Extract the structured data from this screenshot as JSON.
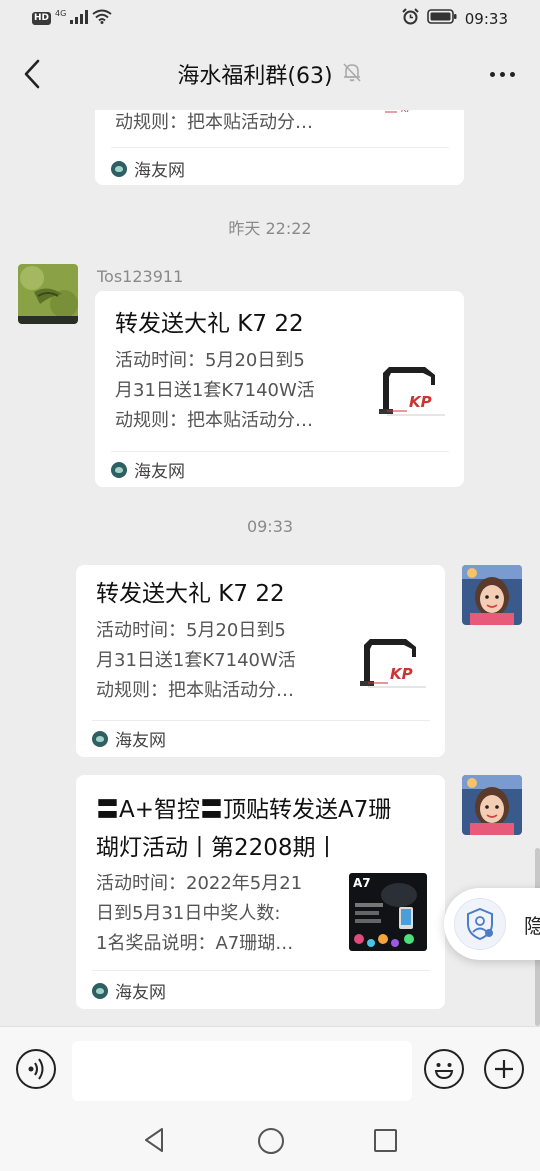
{
  "status_bar": {
    "hd": "HD",
    "network": "4G",
    "time": "09:33"
  },
  "header": {
    "title": "海水福利群(63)",
    "icons": [
      "back-arrow-icon",
      "mute-bell-icon",
      "more-icon"
    ]
  },
  "timestamps": [
    "昨天 22:22",
    "09:33"
  ],
  "messages": [
    {
      "desc_tail": "动规则：把本贴活动分…",
      "source": "海友网"
    },
    {
      "sender": "Tos123911",
      "title": "转发送大礼 K7 22",
      "desc": [
        "活动时间：5月20日到5",
        "月31日送1套K7140W活",
        "动规则：把本贴活动分…"
      ],
      "source": "海友网"
    },
    {
      "title": "转发送大礼 K7 22",
      "desc": [
        "活动时间：5月20日到5",
        "月31日送1套K7140W活",
        "动规则：把本贴活动分…"
      ],
      "source": "海友网"
    },
    {
      "title": [
        "〓A+智控〓顶贴转发送A7珊",
        "瑚灯活动丨第2208期丨"
      ],
      "desc": [
        "活动时间：2022年5月21",
        "日到5月31日中奖人数:",
        "1名奖品说明：A7珊瑚…"
      ],
      "source": "海友网",
      "thumb_text": "A7"
    }
  ],
  "floating": {
    "label": "隐"
  },
  "bottom": {
    "icons": [
      "voice-icon",
      "emoji-icon",
      "plus-icon",
      "nav-back-icon",
      "nav-home-icon",
      "nav-recent-icon"
    ]
  },
  "colors": {
    "background": "#ededed",
    "card": "#ffffff",
    "muted_text": "#8a8a8a"
  }
}
